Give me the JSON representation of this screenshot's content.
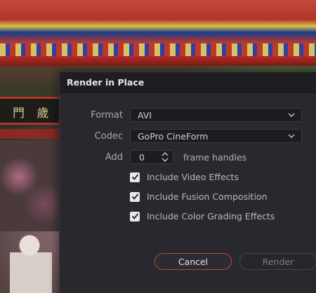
{
  "background": {
    "sign_text": "門 歲 ..."
  },
  "dialog": {
    "title": "Render in Place",
    "format": {
      "label": "Format",
      "value": "AVI"
    },
    "codec": {
      "label": "Codec",
      "value": "GoPro CineForm"
    },
    "add": {
      "label": "Add",
      "value": "0",
      "suffix": "frame handles"
    },
    "options": [
      {
        "label": "Include Video Effects",
        "checked": true
      },
      {
        "label": "Include Fusion Composition",
        "checked": true
      },
      {
        "label": "Include Color Grading Effects",
        "checked": true
      }
    ],
    "buttons": {
      "cancel": "Cancel",
      "render": "Render"
    }
  },
  "colors": {
    "dialog_bg": "#28282e",
    "header_bg": "#1e1e22",
    "accent_cancel_border": "#c8442e",
    "checkbox_bg": "#e8e8ea"
  }
}
